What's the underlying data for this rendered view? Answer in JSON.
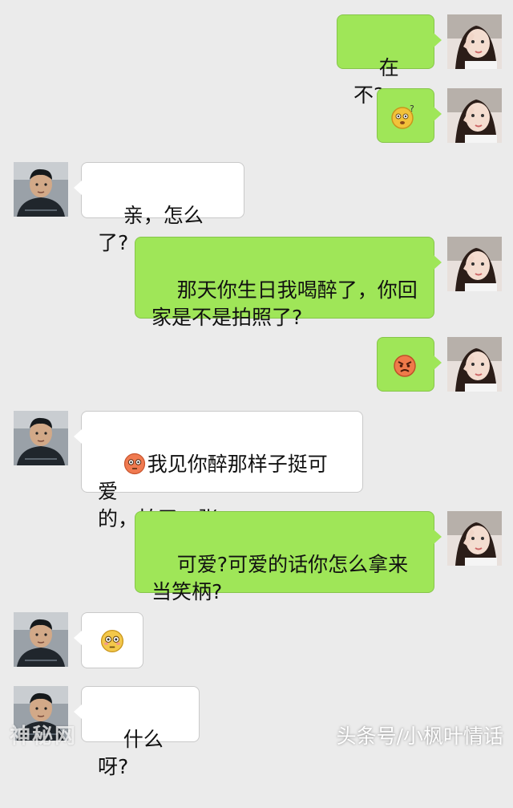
{
  "chat": {
    "messages": [
      {
        "from": "me",
        "text": "在不?"
      },
      {
        "from": "me",
        "emoji": "dizzy-face-emoji"
      },
      {
        "from": "friend",
        "text": "亲，怎么了?"
      },
      {
        "from": "me",
        "text": "那天你生日我喝醉了，你回\n家是不是拍照了?"
      },
      {
        "from": "me",
        "emoji": "angry-face-emoji"
      },
      {
        "from": "friend",
        "emoji_prefix": "flushed-face-emoji",
        "text": "我见你醉那样子挺可爱\n的，拍了一张"
      },
      {
        "from": "me",
        "text": "可爱?可爱的话你怎么拿来\n当笑柄?"
      },
      {
        "from": "friend",
        "emoji": "flushed-face-emoji"
      },
      {
        "from": "friend",
        "text": "什么呀?"
      }
    ]
  },
  "watermark": {
    "left": "神秘网",
    "right": "头条号/小枫叶情话"
  },
  "colors": {
    "background": "#ebebeb",
    "outgoing_bubble": "#9fe658",
    "incoming_bubble": "#ffffff"
  }
}
